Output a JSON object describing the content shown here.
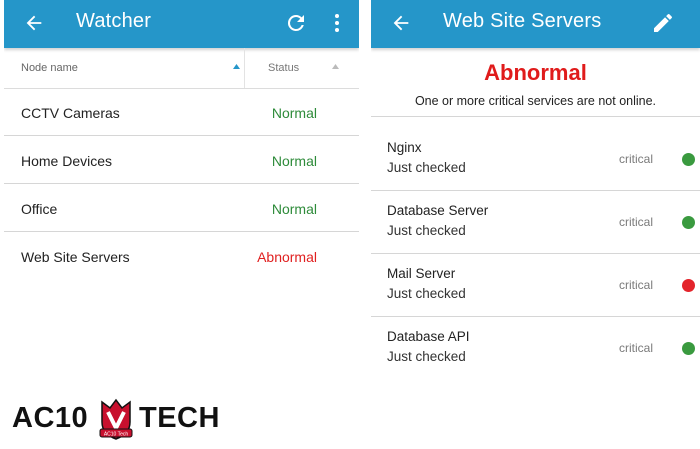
{
  "left": {
    "title": "Watcher",
    "header": {
      "name": "Node name",
      "status": "Status"
    },
    "rows": [
      {
        "name": "CCTV Cameras",
        "status": "Normal"
      },
      {
        "name": "Home Devices",
        "status": "Normal"
      },
      {
        "name": "Office",
        "status": "Normal"
      },
      {
        "name": "Web Site Servers",
        "status": "Abnormal"
      }
    ]
  },
  "right": {
    "title": "Web Site Servers",
    "status": "Abnormal",
    "message": "One or more critical services are not online.",
    "services": [
      {
        "name": "Nginx",
        "checked": "Just checked",
        "level": "critical",
        "state": "ok"
      },
      {
        "name": "Database Server",
        "checked": "Just checked",
        "level": "critical",
        "state": "ok"
      },
      {
        "name": "Mail Server",
        "checked": "Just checked",
        "level": "critical",
        "state": "down"
      },
      {
        "name": "Database API",
        "checked": "Just checked",
        "level": "critical",
        "state": "ok"
      }
    ]
  },
  "logo": {
    "part1": "AC10",
    "part2": "TECH",
    "badge": "AC10 Tech"
  },
  "colors": {
    "appbar": "#2596c9",
    "normal": "#2e8b3a",
    "abnormal": "#e02020",
    "ok_dot": "#3a9a3f",
    "down_dot": "#e3242b"
  },
  "icons": {
    "back": "arrow-left-icon",
    "refresh": "refresh-icon",
    "more": "more-vert-icon",
    "edit": "pencil-icon"
  }
}
